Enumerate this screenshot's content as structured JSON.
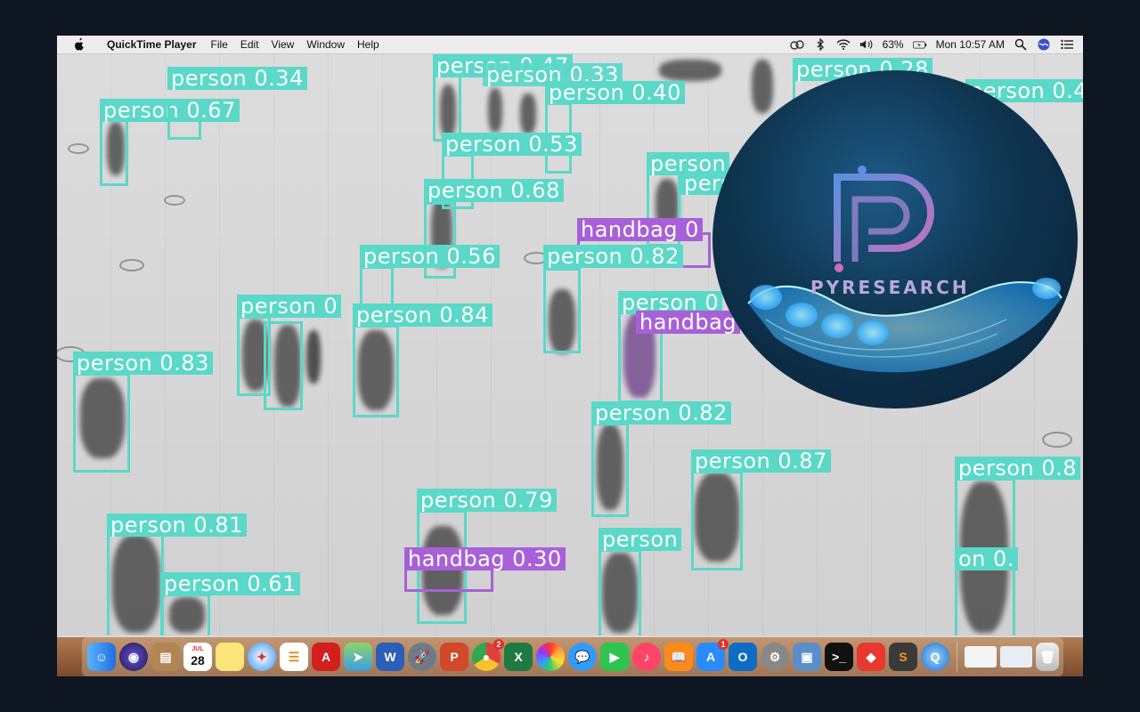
{
  "menubar": {
    "app_name": "QuickTime Player",
    "menus": [
      "File",
      "Edit",
      "View",
      "Window",
      "Help"
    ],
    "battery": "63%",
    "clock": "Mon 10:57 AM"
  },
  "detections": [
    {
      "label": "person 0.47"
    },
    {
      "label": "person 0.33"
    },
    {
      "label": "person 0.40"
    },
    {
      "label": "person 0.34"
    },
    {
      "label": "person 0.67"
    },
    {
      "label": "person 0.53"
    },
    {
      "label": "person 0.68"
    },
    {
      "label": "person 0.28"
    },
    {
      "label": "person 0.4"
    },
    {
      "label": "person 0"
    },
    {
      "label": "person 0.56"
    },
    {
      "label": "person 0.82"
    },
    {
      "label": "person 0"
    },
    {
      "label": "person 0.84"
    },
    {
      "label": "person 0.83"
    },
    {
      "label": "person 0.82"
    },
    {
      "label": "person 0.87"
    },
    {
      "label": "person 0.8"
    },
    {
      "label": "person 0.79"
    },
    {
      "label": "person 0.81"
    },
    {
      "label": "person 0.61"
    },
    {
      "label": "person"
    },
    {
      "label": "handbag 0.30"
    },
    {
      "label": "handbag 0"
    },
    {
      "label": "handbag"
    },
    {
      "label": "person"
    },
    {
      "label": "person"
    },
    {
      "label": "on 0."
    }
  ],
  "logo": {
    "text": "PYRESEARCH",
    "colors": {
      "bg": "#0f3550",
      "accent": "#9a86d0",
      "hand": "#28b8ff"
    }
  },
  "dock": {
    "calendar": {
      "month": "JUL",
      "day": "28"
    },
    "apps": [
      "finder-icon",
      "siri-icon",
      "contacts-icon",
      "calendar-icon",
      "notes-icon",
      "safari-icon",
      "reminders-icon",
      "acrobat-icon",
      "maps-icon",
      "word-icon",
      "launchpad-icon",
      "powerpoint-icon",
      "chrome-icon",
      "excel-icon",
      "photos-icon",
      "messages-icon",
      "facetime-icon",
      "music-icon",
      "books-icon",
      "appstore-icon",
      "outlook-icon",
      "settings-icon",
      "preview-icon",
      "terminal-icon",
      "anydesk-icon",
      "sublime-icon",
      "quicktime-icon"
    ],
    "badges": {
      "chrome": "2",
      "appstore": "1"
    }
  },
  "colors": {
    "person_box": "#5ad8c8",
    "handbag_box": "#a860d8"
  }
}
